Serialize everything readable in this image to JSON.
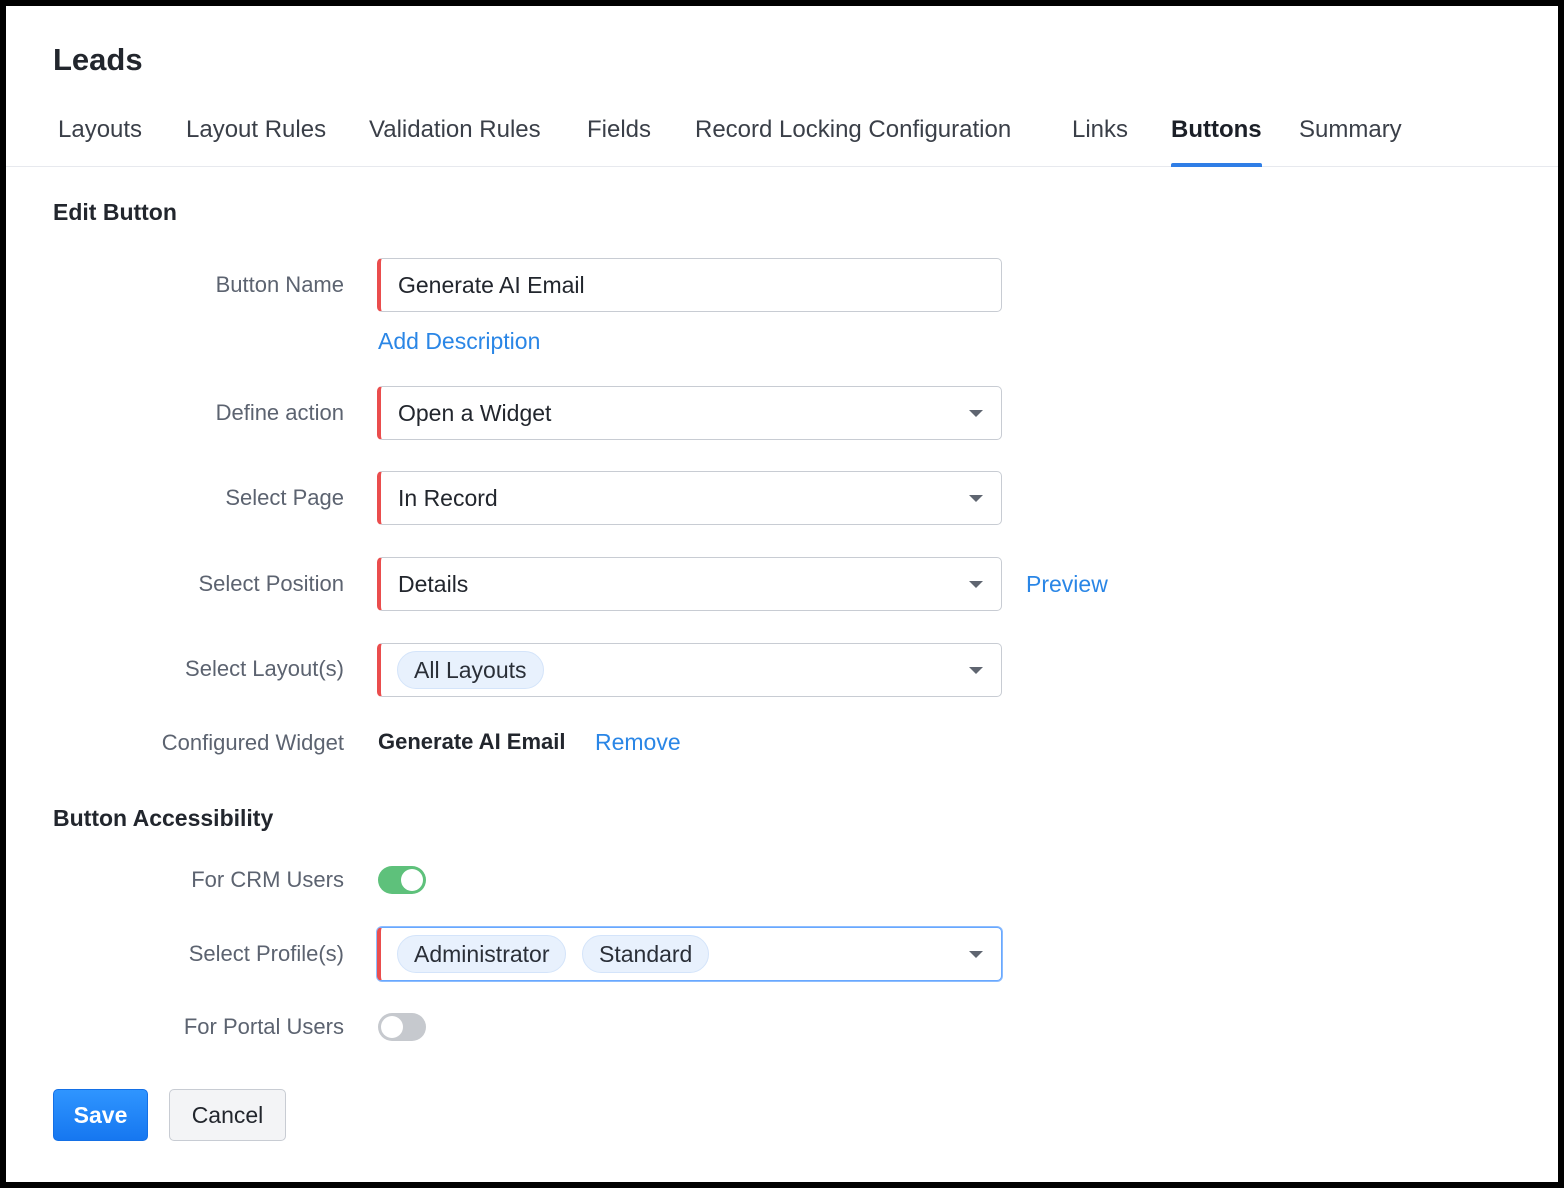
{
  "module": {
    "title": "Leads"
  },
  "tabs": [
    {
      "label": "Layouts",
      "active": false
    },
    {
      "label": "Layout Rules",
      "active": false
    },
    {
      "label": "Validation Rules",
      "active": false
    },
    {
      "label": "Fields",
      "active": false
    },
    {
      "label": "Record Locking Configuration",
      "active": false
    },
    {
      "label": "Links",
      "active": false
    },
    {
      "label": "Buttons",
      "active": true
    },
    {
      "label": "Summary",
      "active": false
    }
  ],
  "edit_button": {
    "section_title": "Edit Button",
    "button_name": {
      "label": "Button Name",
      "value": "Generate AI Email"
    },
    "add_description": "Add Description",
    "define_action": {
      "label": "Define action",
      "value": "Open a Widget"
    },
    "select_page": {
      "label": "Select Page",
      "value": "In Record"
    },
    "select_position": {
      "label": "Select Position",
      "value": "Details",
      "preview_link": "Preview"
    },
    "select_layouts": {
      "label": "Select Layout(s)",
      "chips": [
        "All Layouts"
      ]
    },
    "configured_widget": {
      "label": "Configured Widget",
      "value": "Generate AI Email",
      "remove_link": "Remove"
    }
  },
  "accessibility": {
    "section_title": "Button Accessibility",
    "crm_users": {
      "label": "For CRM Users",
      "enabled": true
    },
    "select_profiles": {
      "label": "Select Profile(s)",
      "chips": [
        "Administrator",
        "Standard"
      ]
    },
    "portal_users": {
      "label": "For Portal Users",
      "enabled": false
    }
  },
  "actions": {
    "save": "Save",
    "cancel": "Cancel"
  },
  "colors": {
    "accent": "#2f7ee6",
    "link": "#2a86e6",
    "required_marker": "#ea4d4d",
    "toggle_on": "#5ec17b",
    "toggle_off": "#c6c9ce"
  }
}
